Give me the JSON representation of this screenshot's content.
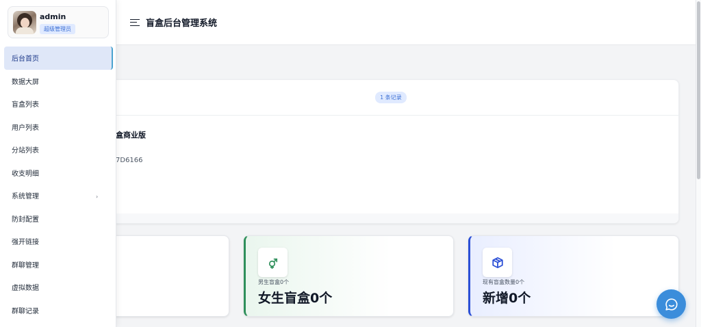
{
  "header": {
    "title": "盲盒后台管理系统"
  },
  "user": {
    "name": "admin",
    "role": "超级管理员"
  },
  "sidebar": {
    "items": [
      {
        "label": "后台首页",
        "active": true
      },
      {
        "label": "数据大屏"
      },
      {
        "label": "盲盒列表"
      },
      {
        "label": "用户列表"
      },
      {
        "label": "分站列表"
      },
      {
        "label": "收支明细"
      },
      {
        "label": "系统管理",
        "has_submenu": true,
        "chevron": "›"
      },
      {
        "label": "防封配置"
      },
      {
        "label": "强开链接"
      },
      {
        "label": "群聊管理"
      },
      {
        "label": "虚拟数据"
      },
      {
        "label": "群聊记录"
      }
    ]
  },
  "info_card": {
    "badge": "1 条记录",
    "line1": "盒商业版",
    "line2": "7D6166"
  },
  "stats": [
    {
      "label": "",
      "value": "",
      "icon": "none"
    },
    {
      "label": "男生盲盒0个",
      "value": "女生盲盒0个",
      "icon": "gender-icon",
      "accent": "#2f8f5b"
    },
    {
      "label": "现有盲盒数量0个",
      "value": "新增0个",
      "icon": "box-icon",
      "accent": "#2b4fd6"
    }
  ],
  "colors": {
    "accent_blue": "#3b6fd4",
    "active_menu_bg": "#dfe7f8",
    "chat_button": "#3b8ddb"
  },
  "chat_button": {
    "icon": "chat-icon"
  }
}
